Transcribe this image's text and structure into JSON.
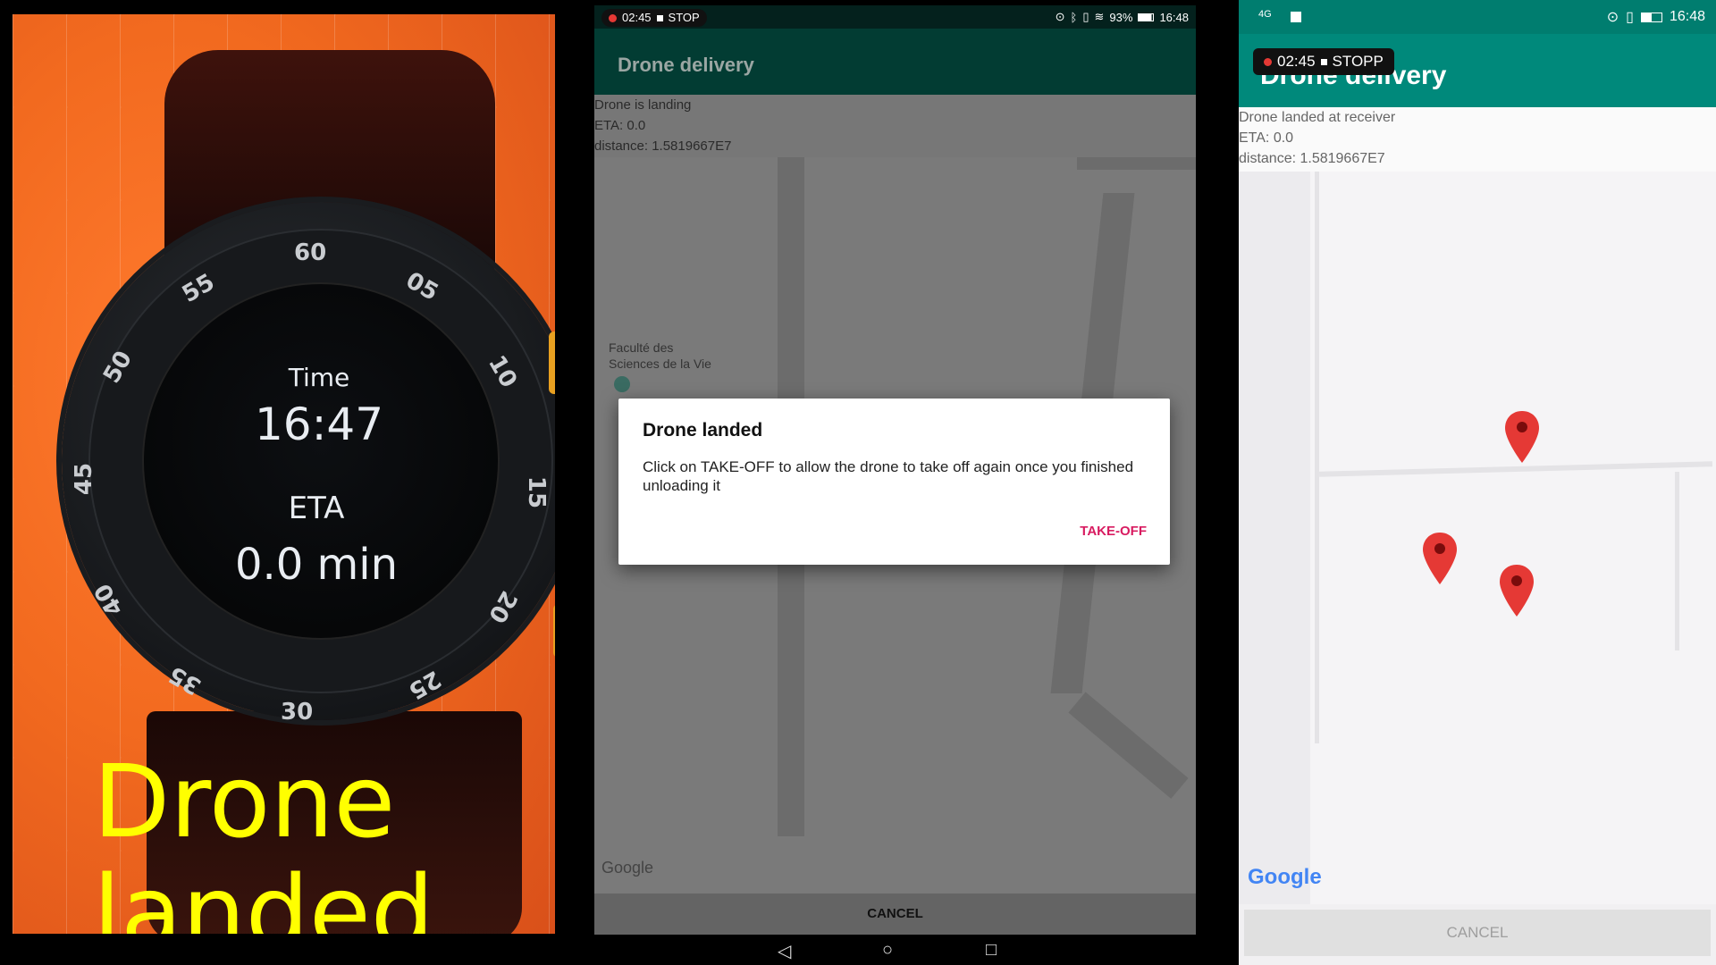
{
  "watch": {
    "bezel_numbers": [
      "60",
      "05",
      "10",
      "15",
      "20",
      "25",
      "30",
      "35",
      "40",
      "45",
      "50",
      "55"
    ],
    "time_label": "Time",
    "time_value": "16:47",
    "eta_label": "ETA",
    "eta_value": "0.0 min",
    "overlay_line1": "Drone",
    "overlay_line2": "landed"
  },
  "phone_middle": {
    "status": {
      "rec_time": "02:45",
      "stop_label": "STOP",
      "battery": "93%",
      "clock": "16:48"
    },
    "app_title": "Drone delivery",
    "info_lines": [
      "Drone is landing",
      "ETA: 0.0",
      "distance: 1.5819667E7"
    ],
    "map_label": "Faculté des\nSciences de la Vie",
    "google_logo": "Google",
    "dialog": {
      "title": "Drone landed",
      "message": "Click on TAKE-OFF to allow the drone to take off again once you finished unloading it",
      "action": "TAKE-OFF"
    },
    "cancel_label": "CANCEL"
  },
  "phone_right": {
    "status": {
      "network": "4G",
      "clock": "16:48"
    },
    "rec_pill": {
      "rec_time": "02:45",
      "stop_label": "STOPP"
    },
    "app_title": "Drone delivery",
    "info_lines": [
      "Drone landed at receiver",
      "ETA: 0.0",
      "distance: 1.5819667E7"
    ],
    "google_logo": "Google",
    "cancel_label": "CANCEL"
  },
  "colors": {
    "appbar_teal": "#00897b",
    "accent_pink": "#d81b60",
    "overlay_yellow": "#ffff00",
    "pin_red": "#e53935"
  }
}
